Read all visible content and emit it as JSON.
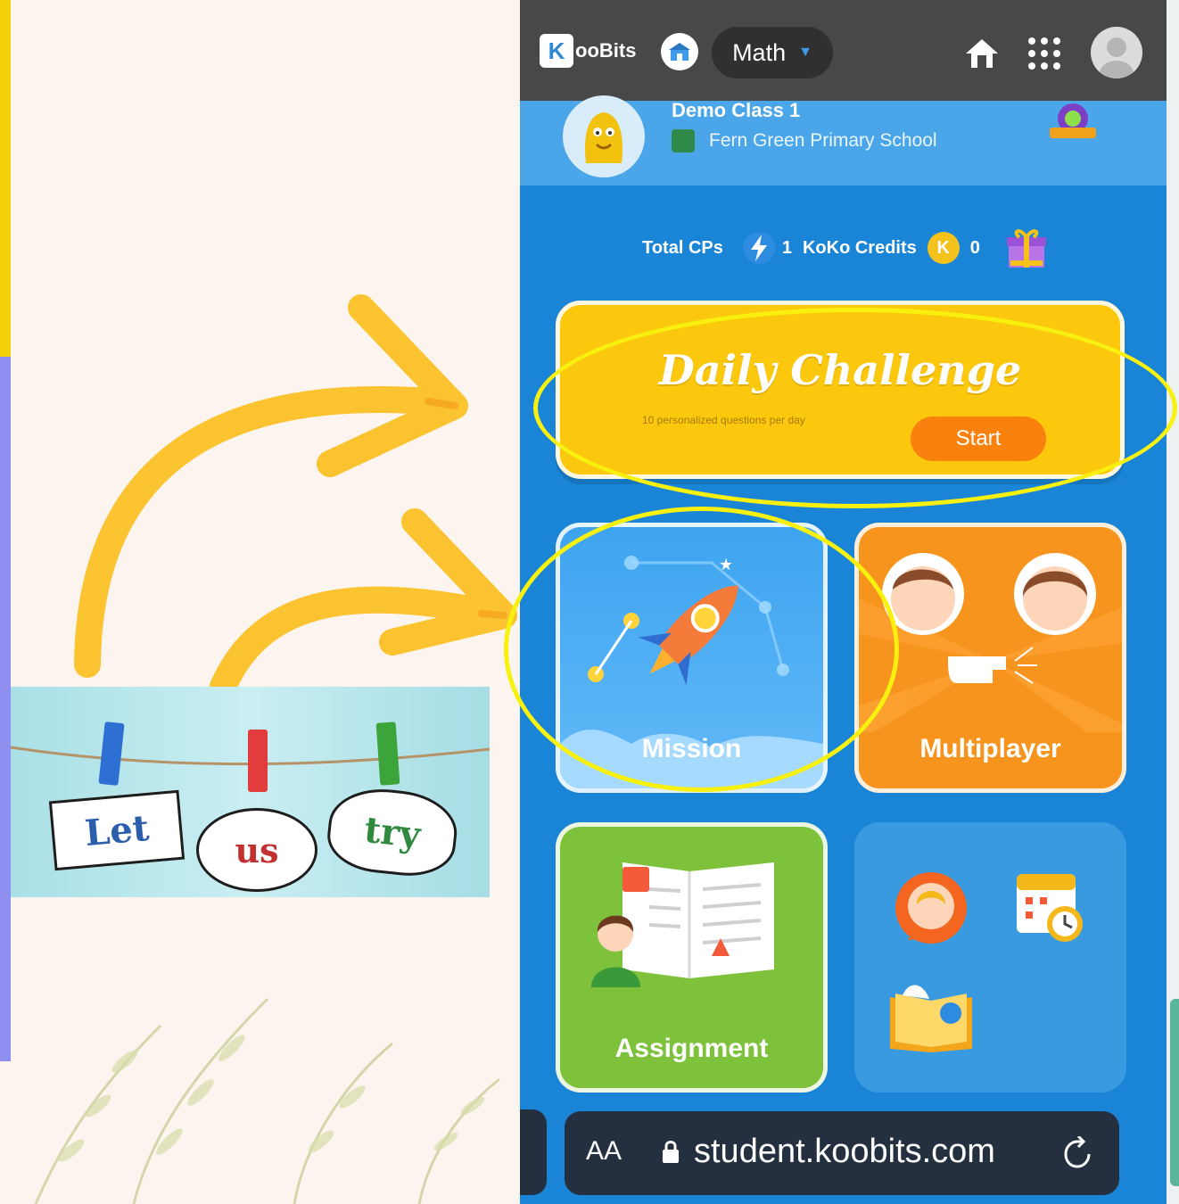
{
  "slide": {
    "words": [
      "Let",
      "us",
      "try"
    ]
  },
  "app": {
    "logo_text": "ooBits",
    "logo_letter": "K",
    "subject": "Math",
    "class_name": "Demo Class 1",
    "school_name": "Fern Green Primary School",
    "stats": {
      "total_cps_label": "Total CPs",
      "cps_value": "1",
      "credits_label": "KoKo Credits",
      "credits_value": "0",
      "coin_letter": "K"
    },
    "daily": {
      "title": "Daily Challenge",
      "subtitle": "10 personalized questions per day",
      "start_label": "Start"
    },
    "tiles": {
      "mission": "Mission",
      "multiplayer": "Multiplayer",
      "assignment": "Assignment"
    }
  },
  "browser": {
    "text_size_label": "AA",
    "url": "student.koobits.com"
  },
  "colors": {
    "highlight": "#f8f00e",
    "arrow": "#fbbf1f",
    "app_blue": "#1a85d6"
  }
}
